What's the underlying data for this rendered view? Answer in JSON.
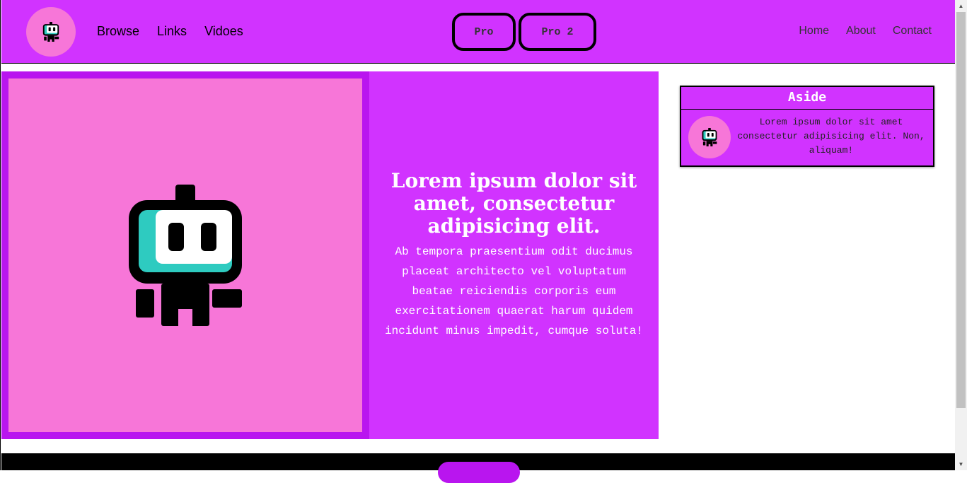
{
  "header": {
    "nav_left": [
      "Browse",
      "Links",
      "Vidoes"
    ],
    "pro_buttons": [
      "Pro",
      "Pro 2"
    ],
    "nav_right": [
      "Home",
      "About",
      "Contact"
    ]
  },
  "hero": {
    "title": "Lorem ipsum dolor sit amet, consectetur adipisicing elit.",
    "body": "Ab tempora praesentium odit ducimus placeat architecto vel voluptatum beatae reiciendis corporis eum exercitationem quaerat harum quidem incidunt minus impedit, cumque soluta!"
  },
  "aside": {
    "title": "Aside",
    "text": "Lorem ipsum dolor sit amet consectetur adipisicing elit. Non, aliquam!"
  },
  "colors": {
    "primary": "#d133ff",
    "accent_dark": "#b915ef",
    "pink": "#f776d8",
    "teal": "#2ecbc0"
  },
  "icons": {
    "logo": "robot-icon",
    "hero": "robot-icon",
    "aside_avatar": "robot-icon"
  }
}
